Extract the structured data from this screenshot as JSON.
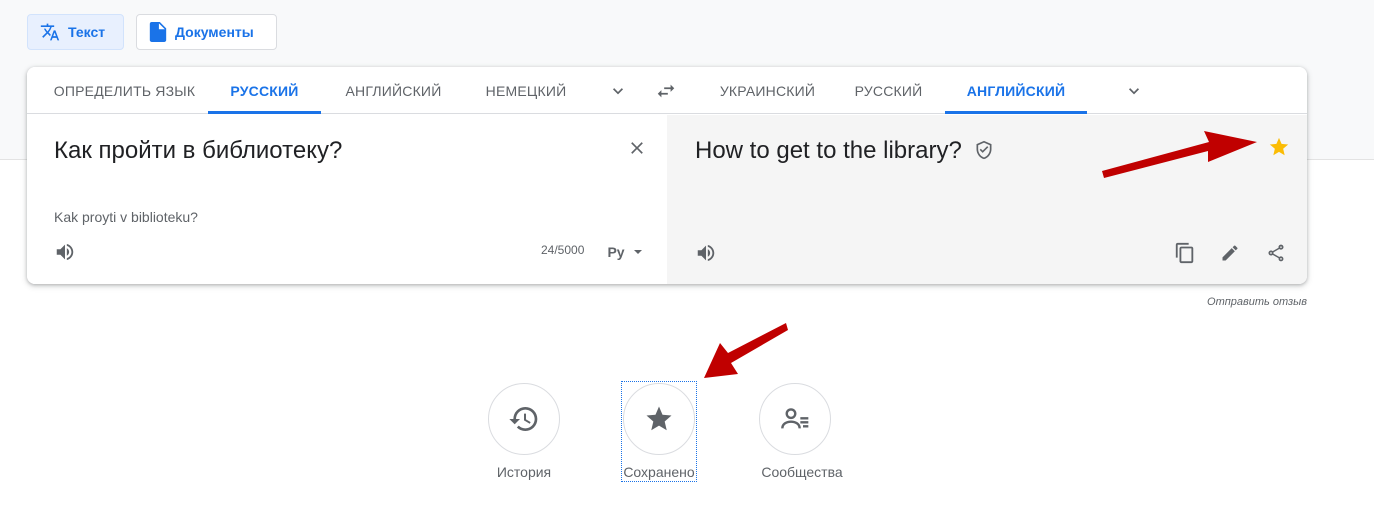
{
  "modes": {
    "text_label": "Текст",
    "docs_label": "Документы"
  },
  "source_langs": [
    {
      "label": "ОПРЕДЕЛИТЬ ЯЗЫК",
      "active": false
    },
    {
      "label": "РУССКИЙ",
      "active": true
    },
    {
      "label": "АНГЛИЙСКИЙ",
      "active": false
    },
    {
      "label": "НЕМЕЦКИЙ",
      "active": false
    }
  ],
  "target_langs": [
    {
      "label": "УКРАИНСКИЙ",
      "active": false
    },
    {
      "label": "РУССКИЙ",
      "active": false
    },
    {
      "label": "АНГЛИЙСКИЙ",
      "active": true
    }
  ],
  "source": {
    "text": "Как пройти в библиотеку?",
    "transliteration": "Kak proyti v biblioteku?",
    "counter": "24/5000",
    "input_method": "Ру"
  },
  "target": {
    "text": "How to get to the library?"
  },
  "feedback_label": "Отправить отзыв",
  "bottom_buttons": [
    {
      "label": "История",
      "icon": "history-icon"
    },
    {
      "label": "Сохранено",
      "icon": "star-icon"
    },
    {
      "label": "Сообщества",
      "icon": "people-icon"
    }
  ],
  "colors": {
    "accent": "#1a73e8",
    "star": "#fbbc04",
    "annotation_arrow": "#c00000"
  }
}
